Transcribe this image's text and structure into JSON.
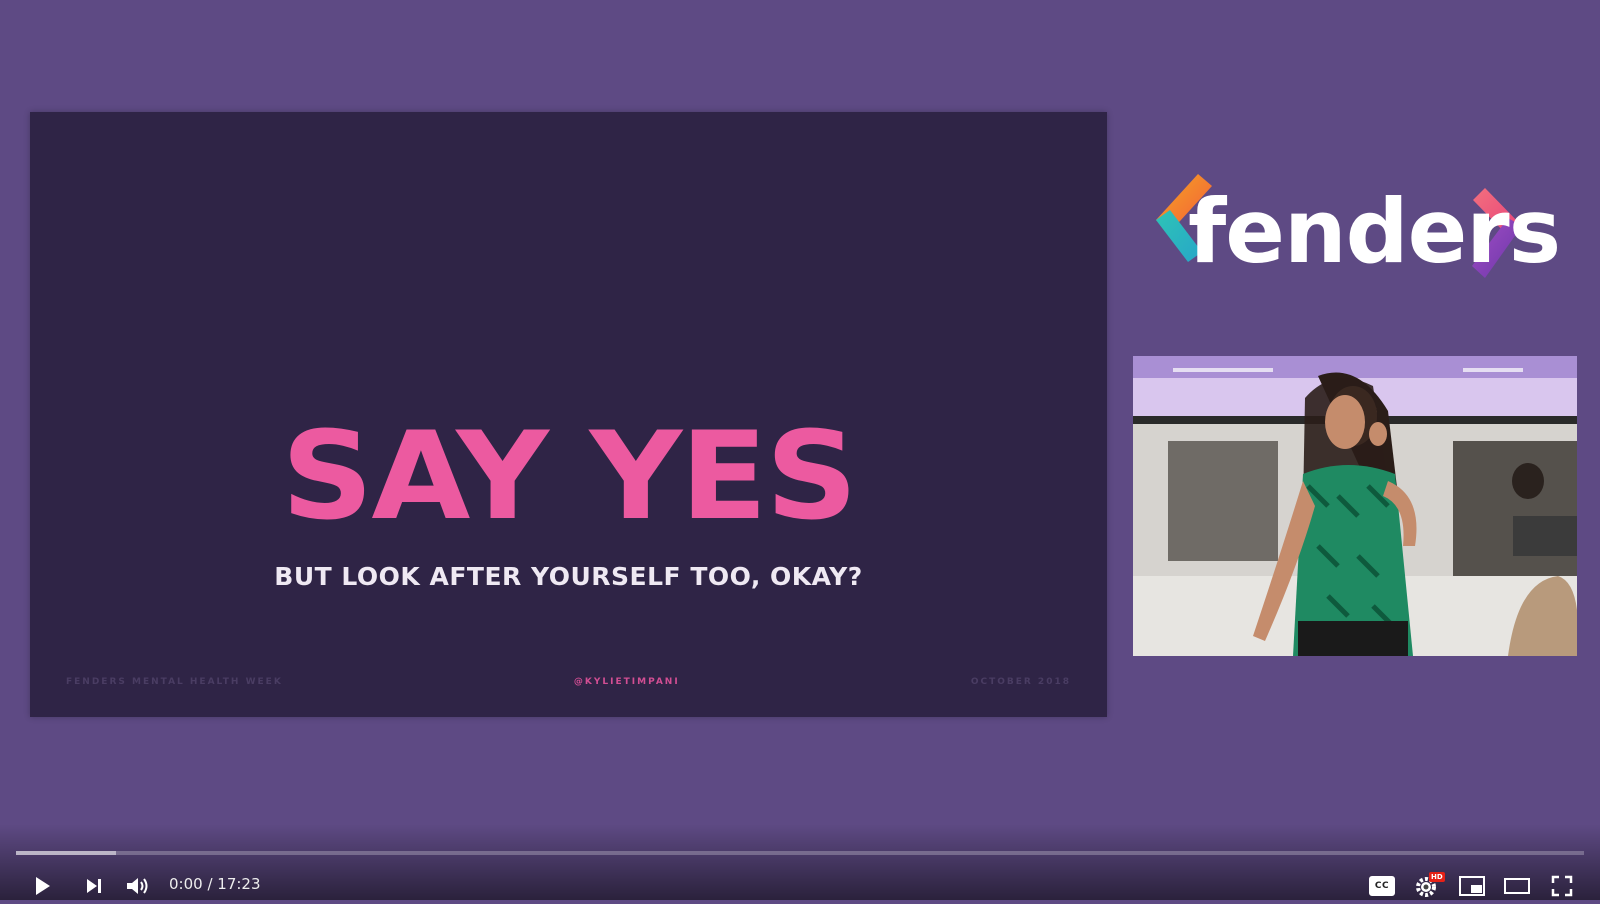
{
  "slide": {
    "title": "SAY YES",
    "subtitle": "BUT LOOK AFTER YOURSELF TOO, OKAY?",
    "footer_left": "FENDERS MENTAL HEALTH WEEK",
    "footer_center": "@KYLIETIMPANI",
    "footer_right": "OCTOBER 2018"
  },
  "logo": {
    "text": "fenders",
    "colors": [
      "#f6a623",
      "#e8407a",
      "#2ec4b6",
      "#7b3fb8"
    ]
  },
  "player": {
    "current_time": "0:00",
    "separator": " / ",
    "duration": "17:23",
    "progress": 0.0,
    "buffered": 0.064,
    "icons": [
      "play-icon",
      "next-icon",
      "volume-icon",
      "captions-icon",
      "settings-icon",
      "miniplayer-icon",
      "theater-icon",
      "fullscreen-icon"
    ],
    "settings_badge": "HD",
    "cc_label": "CC",
    "accent": "#ff0000"
  }
}
